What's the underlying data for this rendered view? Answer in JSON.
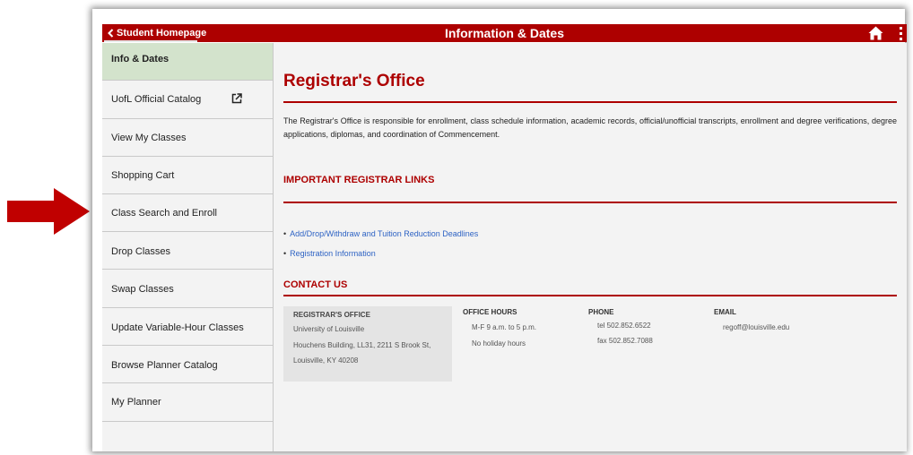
{
  "header": {
    "back_label": "Student Homepage",
    "title": "Information & Dates",
    "home_icon": "home-icon",
    "more_icon": "more-vertical-icon"
  },
  "sidebar": {
    "items": [
      {
        "label": "Info & Dates"
      },
      {
        "label": "UofL Official Catalog",
        "icon": "external-link-icon"
      },
      {
        "label": "View My Classes"
      },
      {
        "label": "Shopping Cart"
      },
      {
        "label": "Class Search and Enroll"
      },
      {
        "label": "Drop Classes"
      },
      {
        "label": "Swap Classes"
      },
      {
        "label": "Update Variable-Hour Classes"
      },
      {
        "label": "Browse Planner Catalog"
      },
      {
        "label": "My Planner"
      }
    ]
  },
  "main": {
    "title": "Registrar's Office",
    "intro": "The Registrar's Office is responsible for enrollment, class schedule information, academic records, official/unofficial transcripts, enrollment and degree verifications, degree applications, diplomas, and coordination of Commencement.",
    "links_heading": "IMPORTANT REGISTRAR LINKS",
    "links": [
      "Add/Drop/Withdraw and Tuition Reduction Deadlines",
      "Registration Information"
    ],
    "contact_heading": "CONTACT US",
    "office": {
      "title": "REGISTRAR'S OFFICE",
      "lines": [
        "University of Louisville",
        "Houchens Building, LL31, 2211 S Brook St,",
        "Louisville, KY 40208"
      ]
    },
    "hours": {
      "heading": "OFFICE HOURS",
      "lines": [
        "M-F 9 a.m. to 5 p.m.",
        "No holiday hours"
      ]
    },
    "phone": {
      "heading": "PHONE",
      "lines": [
        "tel 502.852.6522",
        "fax 502.852.7088"
      ]
    },
    "email": {
      "heading": "EMAIL",
      "lines": [
        "regoff@louisville.edu"
      ]
    }
  },
  "colors": {
    "brand_red": "#ad0000",
    "active_item": "#d3e3cc",
    "link_blue": "#2e63c4",
    "annotation_arrow": "#c00000"
  }
}
